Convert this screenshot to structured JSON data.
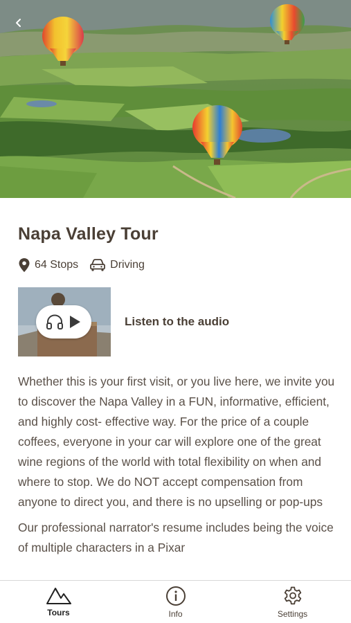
{
  "tour": {
    "title": "Napa Valley Tour",
    "stops": "64 Stops",
    "mode": "Driving"
  },
  "audio": {
    "label": "Listen to the audio"
  },
  "description": {
    "paragraph1": "Whether this is your first visit, or you live here, we invite you to discover the Napa Valley in a FUN, informative, efficient, and highly cost- effective way. For the price of a couple coffees, everyone in your car will explore one of the great wine regions of the world with total flexibility on when and where to stop. We do NOT accept compensation from anyone to direct you, and there is no upselling or pop-ups",
    "paragraph2": "Our professional narrator's resume includes being the voice of multiple characters in a Pixar"
  },
  "tabs": [
    {
      "label": "Tours",
      "icon": "mountain-icon",
      "active": true
    },
    {
      "label": "Info",
      "icon": "info-icon",
      "active": false
    },
    {
      "label": "Settings",
      "icon": "gear-icon",
      "active": false
    }
  ],
  "colors": {
    "text": "#4a3f35",
    "body_text": "#5a5048",
    "divider": "#d8d8d8"
  }
}
